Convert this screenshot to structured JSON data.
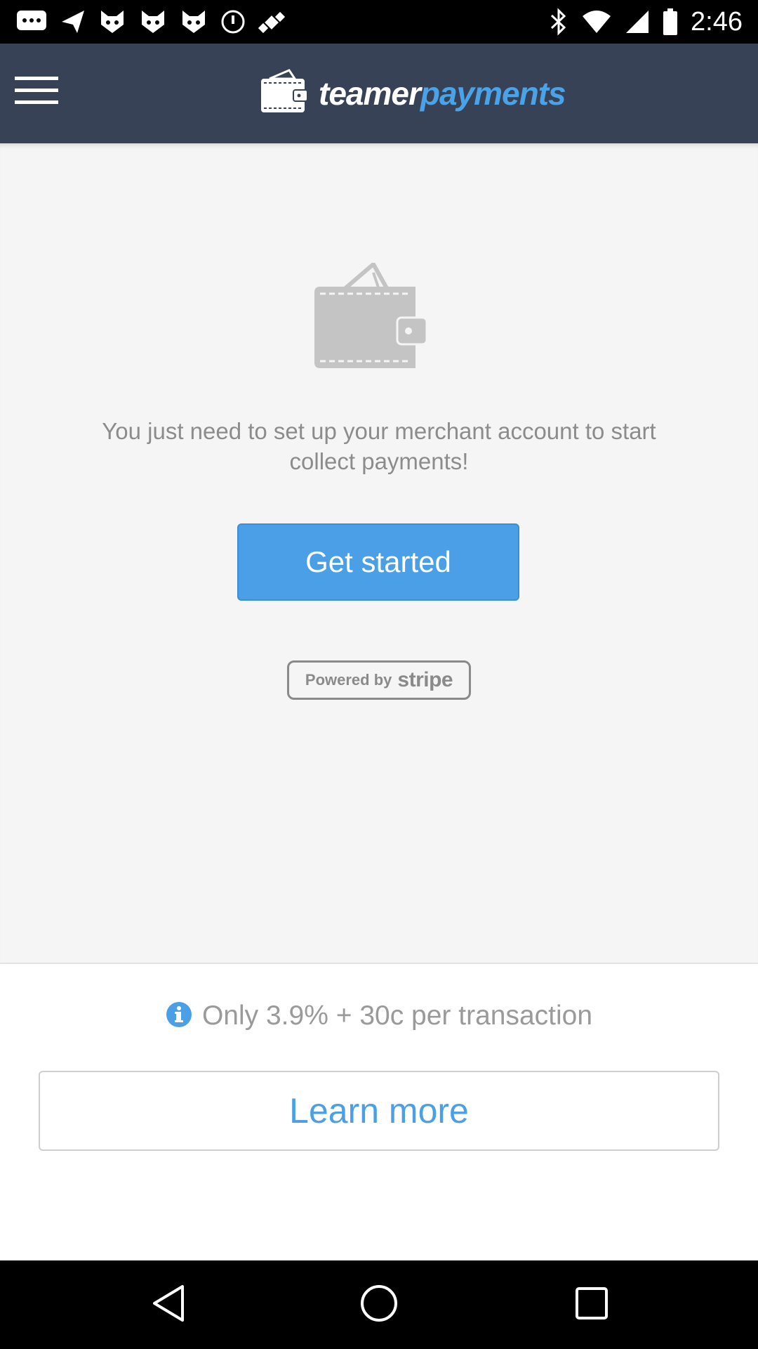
{
  "status_bar": {
    "time": "2:46",
    "left_icons": [
      "messaging-icon",
      "send-icon",
      "cat-face-icon",
      "cat-face-icon",
      "cat-face-icon",
      "no-disturb-icon",
      "fake-gps-satellite-icon"
    ],
    "right_icons": [
      "bluetooth-icon",
      "wifi-icon",
      "signal-icon",
      "battery-icon"
    ]
  },
  "app_bar": {
    "brand_part1": "teamer",
    "brand_part2": "payments",
    "menu_icon": "hamburger-menu-icon"
  },
  "main": {
    "message": "You just need to set up your merchant account to start collect payments!",
    "get_started_label": "Get started",
    "stripe_prefix": "Powered by",
    "stripe_brand": "stripe"
  },
  "bottom": {
    "fee_text": "Only 3.9% + 30c per transaction",
    "learn_more_label": "Learn more"
  },
  "colors": {
    "app_bar": "#374256",
    "accent": "#4a9fe6",
    "background": "#f5f5f5",
    "muted_text": "#8c8c8c"
  }
}
